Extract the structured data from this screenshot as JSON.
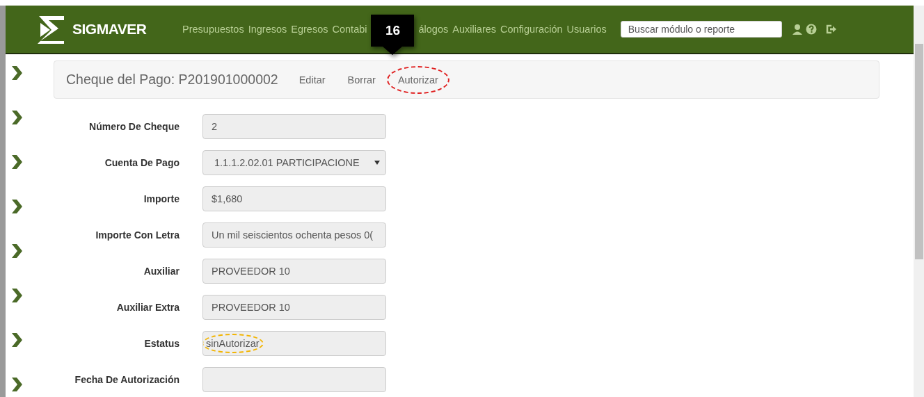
{
  "header": {
    "brand": "SIGMAVER",
    "nav": [
      {
        "label": "Presupuestos"
      },
      {
        "label": "Ingresos"
      },
      {
        "label": "Egresos"
      },
      {
        "label": "Contabi"
      },
      {
        "label": "álogos"
      },
      {
        "label": "Auxiliares"
      },
      {
        "label": "Configuración"
      },
      {
        "label": "Usuarios"
      }
    ],
    "search": {
      "placeholder": "Buscar módulo o reporte"
    }
  },
  "callout": {
    "number": "16"
  },
  "panel": {
    "title": "Cheque del Pago: P201901000002",
    "actions": [
      {
        "label": "Editar"
      },
      {
        "label": "Borrar"
      },
      {
        "label": "Autorizar",
        "highlighted": true
      }
    ]
  },
  "form": [
    {
      "label": "Número De Cheque",
      "kind": "input",
      "value": "2"
    },
    {
      "label": "Cuenta De Pago",
      "kind": "select",
      "value": "1.1.1.2.02.01 PARTICIPACIONE"
    },
    {
      "label": "Importe",
      "kind": "input",
      "value": "$1,680"
    },
    {
      "label": "Importe Con Letra",
      "kind": "input",
      "value": "Un mil seiscientos ochenta pesos 0("
    },
    {
      "label": "Auxiliar",
      "kind": "input",
      "value": "PROVEEDOR 10"
    },
    {
      "label": "Auxiliar Extra",
      "kind": "input",
      "value": "PROVEEDOR 10"
    },
    {
      "label": "Estatus",
      "kind": "input",
      "value": "sinAutorizar",
      "highlighted": true
    },
    {
      "label": "Fecha De Autorización",
      "kind": "input"
    }
  ]
}
